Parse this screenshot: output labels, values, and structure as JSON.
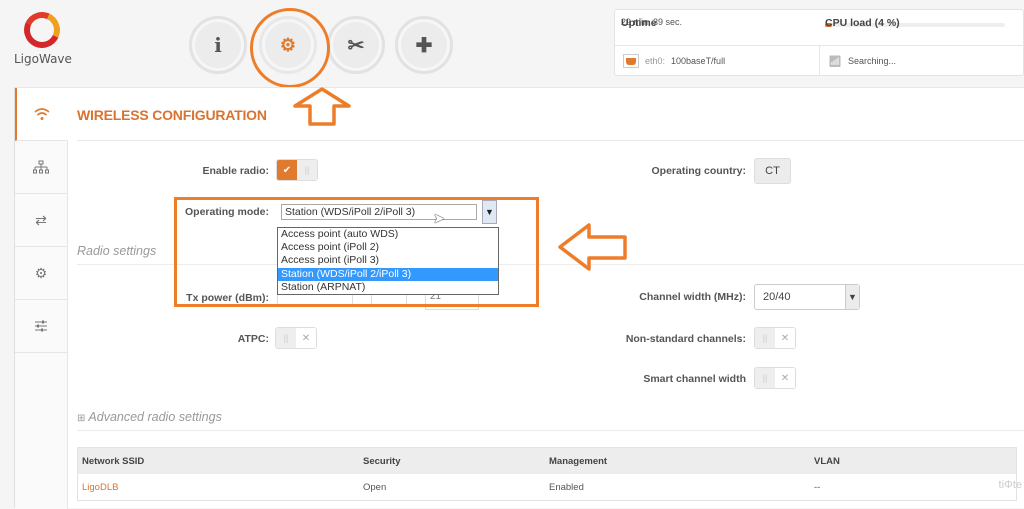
{
  "brand": {
    "name": "LigoWave"
  },
  "top_nav": [
    {
      "id": "status",
      "icon": "info-icon",
      "glyph": "i"
    },
    {
      "id": "settings",
      "icon": "gear-icon",
      "glyph": "⚙",
      "active": true
    },
    {
      "id": "tools",
      "icon": "tools-icon",
      "glyph": "✂"
    },
    {
      "id": "support",
      "icon": "first-aid-kit-icon",
      "glyph": "✚"
    }
  ],
  "status": {
    "uptime_label": "Uptime",
    "uptime_value": "29 min. 39 sec.",
    "cpu_label": "CPU load (4 %)",
    "cpu_percent": 4,
    "eth_label": "eth0:",
    "eth_value": "100baseT/full",
    "wireless_status": "Searching..."
  },
  "sidebar": [
    {
      "icon": "wifi-icon",
      "glyph": "((•))",
      "active": true
    },
    {
      "icon": "network-tree-icon",
      "glyph": "品"
    },
    {
      "icon": "transfer-arrows-icon",
      "glyph": "⇄"
    },
    {
      "icon": "services-gears-icon",
      "glyph": "⚙"
    },
    {
      "icon": "sliders-icon",
      "glyph": "☰"
    }
  ],
  "page": {
    "title": "WIRELESS CONFIGURATION",
    "enable_radio_label": "Enable radio:",
    "enable_radio": true,
    "operating_country_label": "Operating country:",
    "operating_country": "CT",
    "operating_mode_label": "Operating mode:",
    "operating_mode_value": "Station (WDS/iPoll 2/iPoll 3)",
    "operating_mode_options": [
      "Access point (auto WDS)",
      "Access point (iPoll 2)",
      "Access point (iPoll 3)",
      "Station (WDS/iPoll 2/iPoll 3)",
      "Station (ARPNAT)"
    ],
    "operating_mode_selected_index": 3,
    "radio_settings_heading": "Radio settings",
    "tx_power_label": "Tx power (dBm):",
    "tx_power_value": "21",
    "channel_width_label": "Channel width (MHz):",
    "channel_width_value": "20/40",
    "atpc_label": "ATPC:",
    "atpc": false,
    "non_standard_label": "Non-standard channels:",
    "non_standard": false,
    "smart_channel_label": "Smart channel width",
    "smart_channel": false,
    "advanced_heading": "Advanced radio settings",
    "expand_glyph": "⊞"
  },
  "ssid_table": {
    "headers": [
      "Network SSID",
      "Security",
      "Management",
      "VLAN"
    ],
    "rows": [
      [
        "LigoDLB",
        "Open",
        "Enabled",
        "--"
      ]
    ]
  },
  "watermark": "tiΦte"
}
